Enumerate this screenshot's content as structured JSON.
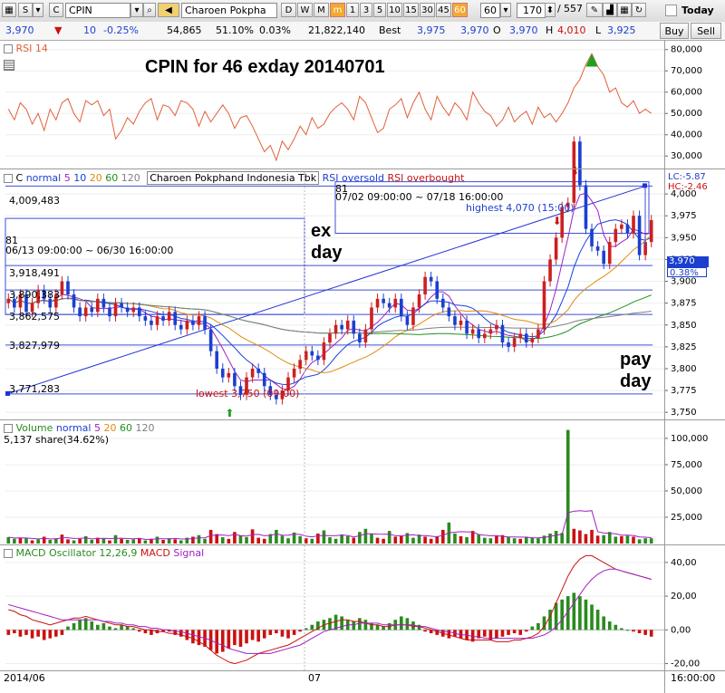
{
  "toolbar": {
    "s_btn": "S",
    "c_btn": "C",
    "symbol": "CPIN",
    "company": "Charoen Pokpha",
    "periods": [
      "D",
      "W",
      "M",
      "m",
      "1",
      "3",
      "5",
      "10",
      "15",
      "30",
      "45",
      "60"
    ],
    "active_period": "60",
    "minutes_value": "60",
    "count_value": "170",
    "count_sep": "/",
    "total_value": "557",
    "today_label": "Today"
  },
  "quote": {
    "last": "3,970",
    "arrow": "▼",
    "change": "10",
    "change_pct": "-0.25%",
    "volume": "54,865",
    "vol_pct": "51.10%",
    "other_pct": "0.03%",
    "value": "21,822,140",
    "best_label": "Best",
    "best_bid": "3,975",
    "best_offer": "3,970",
    "o_label": "O",
    "open": "3,970",
    "h_label": "H",
    "high": "4,010",
    "l_label": "L",
    "low": "3,925",
    "buy_label": "Buy",
    "sell_label": "Sell"
  },
  "colors": {
    "up_candle": "#cc2020",
    "down_candle": "#1c3fd0",
    "volume_up": "#2a8a1f",
    "volume_down": "#cc1010",
    "rsi_line": "#e0603a",
    "ma5": "#a020c0",
    "ma10": "#1840e0",
    "ma20": "#e08a10",
    "ma60": "#209020",
    "ma120": "#808080",
    "accent": "#f4a830"
  },
  "labels": {
    "rsi_title": "RSI 14",
    "price_title_c": "C",
    "price_title_normal": "normal",
    "ma_periods": [
      "5",
      "10",
      "20",
      "60",
      "120"
    ],
    "price_title_name": "Charoen Pokphand Indonesia Tbk",
    "rsi_oversold": "RSI oversold",
    "rsi_overbought": "RSI overbought",
    "lc_label": "LC:-5.87",
    "hc_label": "HC:-2.46",
    "volume_title": "Volume",
    "volume_normal": "normal",
    "volume_ma": [
      "5",
      "20",
      "60",
      "120"
    ],
    "share_label": "5,137 share(34.62%)",
    "macd_title": "MACD Oscillator 12,26,9",
    "macd_label": "MACD",
    "signal_label": "Signal",
    "chart_title": "CPIN for 46 exday 20140701",
    "ex_day": "ex\nday",
    "pay_day": "pay\nday",
    "level_4009": "4,009,483",
    "level_3918": "3,918,491",
    "level_3890": "3,890,383",
    "level_3862": "3,862,575",
    "level_3827": "3,827,979",
    "level_3771": "3,771,283",
    "range_1": "06/13 09:00:00 ~ 06/30 16:00:00",
    "range_2": "07/02 09:00:00 ~ 07/18 16:00:00",
    "label_81a": "81",
    "label_81b": "81",
    "highest": "highest 4,070 (15:00)",
    "lowest": "lowest 3,750 (09:00)",
    "last_price_box": "3,970",
    "last_pct": "0.38%",
    "x_start": "2014/06",
    "x_07": "07",
    "x_time": "16:00:00"
  },
  "chart_data": [
    {
      "type": "line",
      "name": "RSI 14",
      "ylim": [
        25,
        82
      ],
      "yticks": [
        "80,000",
        "70,000",
        "60,000",
        "50,000",
        "40,000",
        "30,000"
      ],
      "yticks_val": [
        80,
        70,
        60,
        50,
        40,
        30
      ],
      "values": [
        52,
        47,
        55,
        52,
        45,
        50,
        42,
        52,
        47,
        55,
        57,
        50,
        46,
        56,
        54,
        56,
        49,
        52,
        38,
        42,
        48,
        45,
        51,
        55,
        57,
        47,
        54,
        53,
        49,
        56,
        55,
        52,
        44,
        51,
        46,
        50,
        54,
        50,
        43,
        48,
        49,
        44,
        38,
        32,
        35,
        28,
        37,
        33,
        38,
        44,
        40,
        48,
        43,
        45,
        50,
        53,
        55,
        52,
        47,
        58,
        55,
        48,
        41,
        43,
        52,
        54,
        57,
        48,
        55,
        60,
        52,
        47,
        58,
        53,
        49,
        55,
        52,
        47,
        60,
        55,
        51,
        49,
        44,
        47,
        53,
        46,
        49,
        51,
        45,
        53,
        48,
        50,
        46,
        50,
        55,
        62,
        66,
        73,
        78,
        72,
        68,
        60,
        62,
        55,
        53,
        56,
        50,
        52,
        50
      ]
    },
    {
      "type": "candlestick",
      "name": "CPIN 60 minute",
      "ylim": [
        3745,
        4025
      ],
      "yticks": [
        "4,000",
        "3,975",
        "3,950",
        "3,925",
        "3,900",
        "3,875",
        "3,850",
        "3,825",
        "3,800",
        "3,775",
        "3,750"
      ],
      "yticks_val": [
        4000,
        3975,
        3950,
        3925,
        3900,
        3875,
        3850,
        3825,
        3800,
        3775,
        3750
      ],
      "closes": [
        3880,
        3870,
        3885,
        3865,
        3875,
        3890,
        3880,
        3870,
        3885,
        3900,
        3885,
        3870,
        3860,
        3870,
        3865,
        3880,
        3870,
        3860,
        3875,
        3870,
        3865,
        3870,
        3860,
        3855,
        3850,
        3860,
        3855,
        3865,
        3850,
        3845,
        3855,
        3850,
        3860,
        3845,
        3820,
        3800,
        3790,
        3795,
        3780,
        3770,
        3790,
        3800,
        3795,
        3780,
        3770,
        3765,
        3775,
        3790,
        3800,
        3810,
        3820,
        3815,
        3810,
        3830,
        3840,
        3850,
        3845,
        3855,
        3840,
        3830,
        3845,
        3870,
        3880,
        3875,
        3870,
        3880,
        3860,
        3850,
        3870,
        3885,
        3905,
        3900,
        3880,
        3870,
        3860,
        3850,
        3855,
        3840,
        3845,
        3835,
        3840,
        3845,
        3850,
        3830,
        3825,
        3835,
        3840,
        3830,
        3835,
        3845,
        3900,
        3925,
        3950,
        3985,
        3990,
        4060,
        4010,
        3960,
        3940,
        3935,
        3920,
        3945,
        3960,
        3965,
        3955,
        3975,
        3930,
        3945,
        3970
      ],
      "last_price": 3970,
      "highest": 4070,
      "lowest": 3750
    },
    {
      "type": "bar",
      "name": "Volume",
      "ylim": [
        0,
        112000
      ],
      "yticks": [
        "100,000",
        "75,000",
        "50,000",
        "25,000"
      ],
      "yticks_val": [
        100000,
        75000,
        50000,
        25000
      ],
      "values": [
        6000,
        4500,
        5500,
        5000,
        3000,
        4000,
        6500,
        3500,
        5000,
        8500,
        4000,
        3000,
        4500,
        7000,
        3500,
        5500,
        4500,
        3000,
        8000,
        4500,
        3500,
        4000,
        5000,
        3000,
        4500,
        6500,
        3500,
        5000,
        4000,
        3000,
        5500,
        6500,
        8000,
        4500,
        13000,
        9000,
        6000,
        4500,
        11000,
        7500,
        6000,
        13500,
        5500,
        4500,
        9000,
        13000,
        7500,
        5000,
        10500,
        7000,
        5000,
        4500,
        9500,
        12500,
        6000,
        4500,
        8500,
        7000,
        5500,
        11000,
        14000,
        9000,
        5500,
        4500,
        12000,
        6500,
        7500,
        10000,
        5500,
        8500,
        6500,
        4500,
        7000,
        13000,
        20000,
        9500,
        7000,
        6000,
        12000,
        8500,
        5500,
        5000,
        7000,
        8000,
        6000,
        5000,
        4500,
        6500,
        5500,
        5000,
        7500,
        9500,
        12000,
        10000,
        108000,
        14000,
        12500,
        9000,
        13000,
        7500,
        8000,
        11000,
        6500,
        7000,
        7500,
        6500,
        4000,
        5000,
        5000
      ],
      "colors": [
        "up",
        "up",
        "down",
        "up",
        "down",
        "up",
        "down",
        "up",
        "up",
        "down",
        "down",
        "up",
        "down",
        "up",
        "up",
        "down",
        "up",
        "down",
        "up",
        "down",
        "up",
        "up",
        "down",
        "up",
        "down",
        "up",
        "down",
        "up",
        "down",
        "up",
        "up",
        "down",
        "up",
        "up",
        "down",
        "down",
        "up",
        "down",
        "down",
        "up",
        "up",
        "down",
        "down",
        "down",
        "up",
        "up",
        "up",
        "up",
        "up",
        "up",
        "down",
        "up",
        "down",
        "up",
        "up",
        "up",
        "up",
        "up",
        "down",
        "up",
        "up",
        "up",
        "down",
        "down",
        "up",
        "down",
        "down",
        "up",
        "up",
        "up",
        "down",
        "down",
        "down",
        "down",
        "up",
        "up",
        "down",
        "up",
        "down",
        "up",
        "up",
        "up",
        "down",
        "down",
        "up",
        "up",
        "down",
        "up",
        "up",
        "up",
        "up",
        "up",
        "up",
        "up",
        "up",
        "down",
        "down",
        "down",
        "down",
        "down",
        "up",
        "up",
        "up",
        "down",
        "up",
        "down",
        "up",
        "up",
        "up"
      ]
    },
    {
      "type": "bar",
      "name": "MACD Oscillator 12,26,9",
      "ylim": [
        -24,
        48
      ],
      "yticks": [
        "40,00",
        "20,00",
        "0,00",
        "-20,00"
      ],
      "yticks_val": [
        40,
        20,
        0,
        -20
      ],
      "values": [
        -3,
        -2,
        -4,
        -3,
        -5,
        -4,
        -6,
        -5,
        -4,
        -3,
        2,
        4,
        6,
        7,
        5,
        3,
        4,
        2,
        1,
        3,
        2,
        1,
        -1,
        -2,
        -3,
        -2,
        -1,
        -1,
        -3,
        -4,
        -6,
        -8,
        -9,
        -10,
        -12,
        -14,
        -13,
        -11,
        -9,
        -10,
        -8,
        -6,
        -7,
        -5,
        -3,
        -2,
        -4,
        -5,
        -3,
        -1,
        1,
        3,
        5,
        6,
        7,
        9,
        8,
        6,
        5,
        7,
        6,
        4,
        3,
        2,
        4,
        6,
        8,
        7,
        5,
        3,
        -1,
        -2,
        -3,
        -4,
        -5,
        -4,
        -5,
        -6,
        -7,
        -5,
        -4,
        -6,
        -5,
        -4,
        -3,
        -2,
        -3,
        -1,
        2,
        4,
        8,
        12,
        16,
        18,
        20,
        22,
        20,
        18,
        15,
        12,
        8,
        5,
        3,
        1,
        0,
        -1,
        -2,
        -3,
        -4
      ],
      "macd_line": [
        12,
        11,
        9,
        8,
        6,
        5,
        4,
        3,
        4,
        5,
        6,
        7,
        7,
        8,
        7,
        6,
        5,
        4,
        3,
        3,
        2,
        2,
        1,
        0,
        0,
        -1,
        -1,
        -2,
        -2,
        -3,
        -4,
        -5,
        -7,
        -9,
        -12,
        -15,
        -17,
        -19,
        -20,
        -19,
        -18,
        -16,
        -14,
        -13,
        -12,
        -11,
        -10,
        -9,
        -7,
        -5,
        -3,
        -1,
        1,
        3,
        4,
        5,
        6,
        6,
        5,
        5,
        4,
        3,
        3,
        2,
        2,
        3,
        3,
        3,
        2,
        2,
        1,
        0,
        -1,
        -2,
        -3,
        -4,
        -5,
        -6,
        -6,
        -6,
        -6,
        -6,
        -7,
        -7,
        -7,
        -6,
        -6,
        -5,
        -4,
        -2,
        2,
        8,
        16,
        24,
        32,
        38,
        42,
        44,
        44,
        42,
        40,
        38,
        36,
        35,
        34,
        33,
        32,
        31,
        30
      ],
      "signal_line": [
        15,
        14,
        13,
        12,
        11,
        10,
        9,
        8,
        7,
        6,
        6,
        6,
        6,
        6,
        6,
        6,
        5,
        5,
        4,
        4,
        3,
        3,
        2,
        2,
        1,
        1,
        0,
        0,
        -1,
        -1,
        -2,
        -3,
        -4,
        -5,
        -6,
        -8,
        -9,
        -11,
        -12,
        -13,
        -14,
        -14,
        -14,
        -14,
        -14,
        -13,
        -12,
        -11,
        -10,
        -9,
        -7,
        -5,
        -3,
        -1,
        0,
        1,
        2,
        3,
        3,
        4,
        4,
        4,
        4,
        3,
        3,
        3,
        3,
        3,
        3,
        2,
        2,
        1,
        0,
        -1,
        -1,
        -2,
        -3,
        -3,
        -4,
        -4,
        -5,
        -5,
        -5,
        -5,
        -5,
        -5,
        -5,
        -5,
        -5,
        -4,
        -3,
        -1,
        2,
        6,
        11,
        16,
        21,
        26,
        30,
        33,
        35,
        36,
        36,
        35,
        34,
        33,
        32,
        31,
        30
      ]
    }
  ]
}
